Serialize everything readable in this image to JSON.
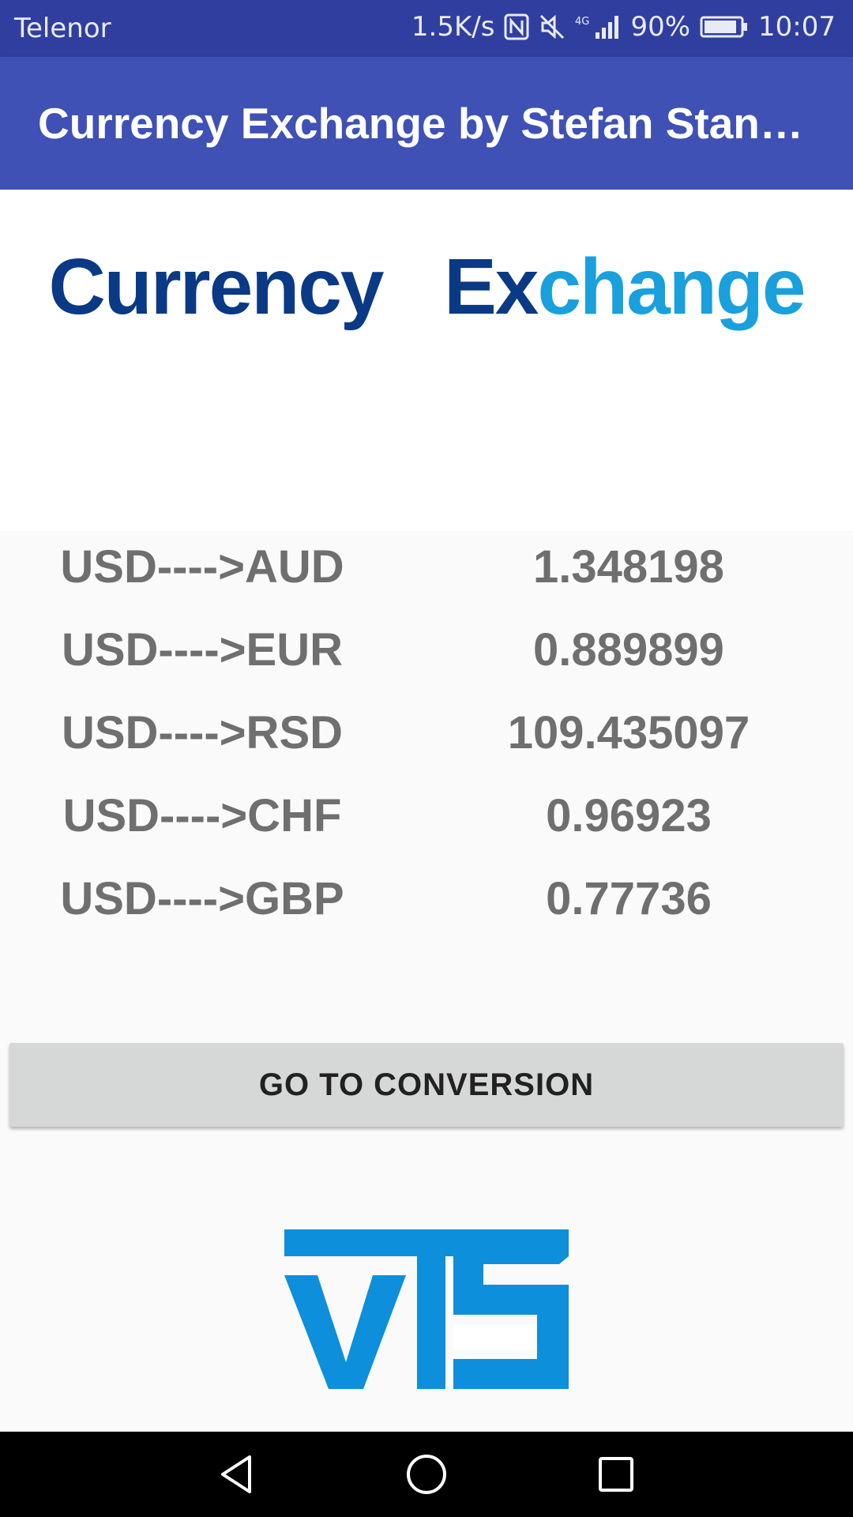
{
  "status_bar": {
    "carrier": "Telenor",
    "speed": "1.5K/s",
    "network": "4G",
    "battery": "90%",
    "time": "10:07",
    "icons": [
      "nfc-icon",
      "mute-icon",
      "signal-icon",
      "battery-icon"
    ]
  },
  "app_bar": {
    "title": "Currency Exchange by Stefan Stan…"
  },
  "header_logo": {
    "word1": "Currency",
    "word2_ex": "Ex",
    "word2_rest": "change"
  },
  "rates": [
    {
      "pair": "USD---->AUD",
      "value": "1.348198"
    },
    {
      "pair": "USD---->EUR",
      "value": "0.889899"
    },
    {
      "pair": "USD---->RSD",
      "value": "109.435097"
    },
    {
      "pair": "USD---->CHF",
      "value": "0.96923"
    },
    {
      "pair": "USD---->GBP",
      "value": "0.77736"
    }
  ],
  "button": {
    "label": "GO TO CONVERSION"
  },
  "footer_logo": {
    "text": "VTS"
  },
  "colors": {
    "status_bar": "#303f9f",
    "app_bar": "#3f51b5",
    "logo_dark": "#0a3a85",
    "logo_light": "#1aa0dc",
    "vts_blue": "#0e8fdb"
  },
  "nav_bar": {
    "icons": [
      "back-icon",
      "home-icon",
      "recents-icon"
    ]
  }
}
